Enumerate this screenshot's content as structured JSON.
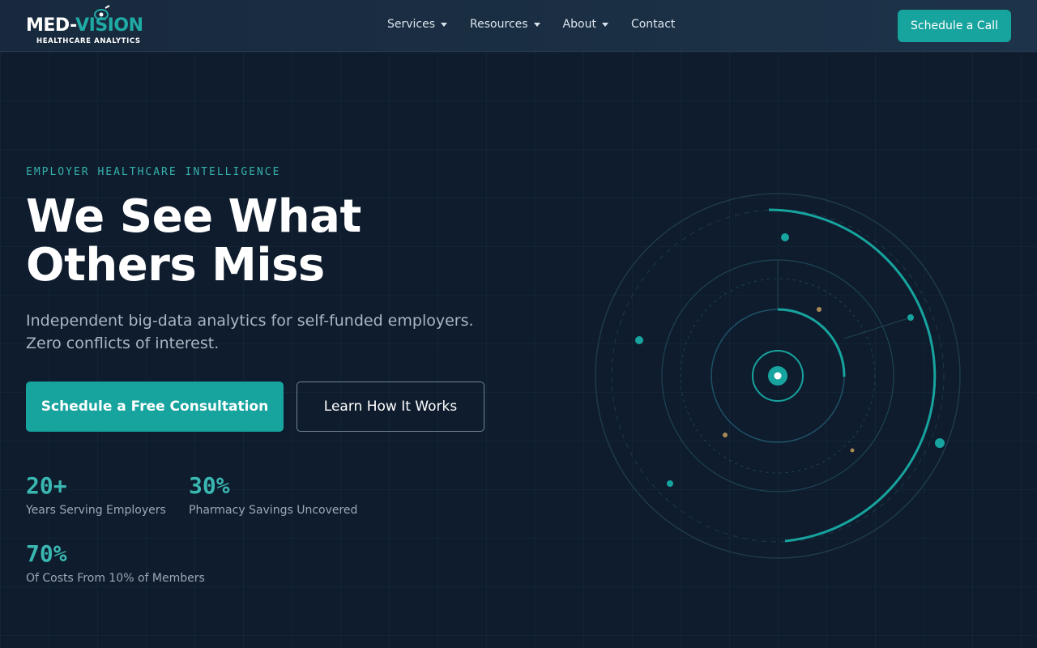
{
  "brand": {
    "name_white": "MED-",
    "name_teal": "VISION",
    "tagline": "HEALTHCARE ANALYTICS"
  },
  "nav": {
    "items": [
      {
        "label": "Services",
        "has_dropdown": true
      },
      {
        "label": "Resources",
        "has_dropdown": true
      },
      {
        "label": "About",
        "has_dropdown": true
      },
      {
        "label": "Contact",
        "has_dropdown": false
      }
    ],
    "cta_label": "Schedule a Call"
  },
  "hero": {
    "eyebrow": "EMPLOYER HEALTHCARE INTELLIGENCE",
    "title_line1": "We See What",
    "title_line2": "Others Miss",
    "subtitle_line1": "Independent big-data analytics for self-funded employers.",
    "subtitle_line2": "Zero conflicts of interest.",
    "primary_button": "Schedule a Free Consultation",
    "secondary_button": "Learn How It Works"
  },
  "stats": [
    {
      "value": "20+",
      "label": "Years Serving Employers"
    },
    {
      "value": "30%",
      "label": "Pharmacy Savings Uncovered"
    },
    {
      "value": "70%",
      "label": "Of Costs From 10% of Members"
    }
  ],
  "colors": {
    "background": "#0e1c2d",
    "header": "#1a2e44",
    "accent": "#17a39e",
    "accent_text": "#35b0ab",
    "muted_text": "#aab6c3",
    "amber_dot": "#a98a55"
  }
}
